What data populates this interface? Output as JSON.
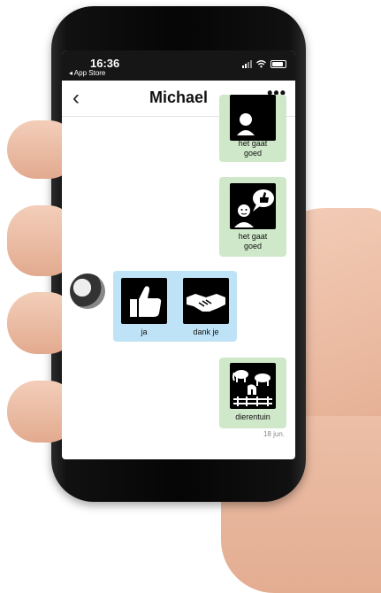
{
  "status_bar": {
    "time": "16:36",
    "back_app": "◂ App Store",
    "icons": [
      "signal-icon",
      "wifi-icon",
      "battery-icon"
    ]
  },
  "header": {
    "title": "Michael",
    "back_glyph": "‹",
    "more_glyph": "•••"
  },
  "messages": [
    {
      "side": "outgoing",
      "color": "#cfe8c9",
      "items": [
        {
          "icon": "person-icon",
          "label_line1": "het gaat",
          "label_line2": "goed"
        }
      ]
    },
    {
      "side": "outgoing",
      "color": "#cfe8c9",
      "items": [
        {
          "icon": "person-thumbs-up-icon",
          "label_line1": "het gaat",
          "label_line2": "goed"
        }
      ]
    },
    {
      "side": "incoming",
      "color": "#bee3f6",
      "items": [
        {
          "icon": "thumbs-up-icon",
          "label": "ja"
        },
        {
          "icon": "handshake-icon",
          "label": "dank je"
        }
      ]
    },
    {
      "side": "outgoing",
      "color": "#cfe8c9",
      "items": [
        {
          "icon": "zoo-animals-icon",
          "label": "dierentuin"
        }
      ]
    }
  ],
  "date_label": "18 jun."
}
